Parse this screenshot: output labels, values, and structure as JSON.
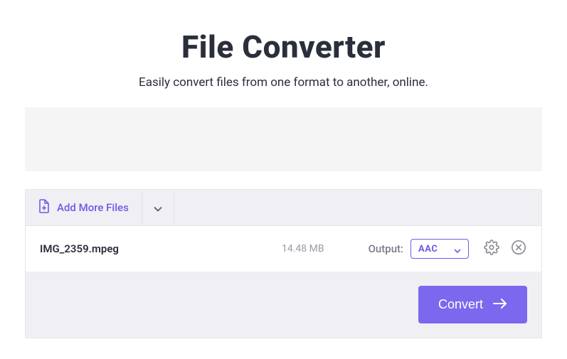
{
  "header": {
    "title": "File Converter",
    "subtitle": "Easily convert files from one format to another, online."
  },
  "toolbar": {
    "add_more_label": "Add More Files"
  },
  "file": {
    "name": "IMG_2359.mpeg",
    "size": "14.48 MB",
    "output_label": "Output:",
    "format": "AAC"
  },
  "actions": {
    "convert_label": "Convert"
  },
  "colors": {
    "accent": "#6c5ce7",
    "button": "#7b68ee"
  }
}
